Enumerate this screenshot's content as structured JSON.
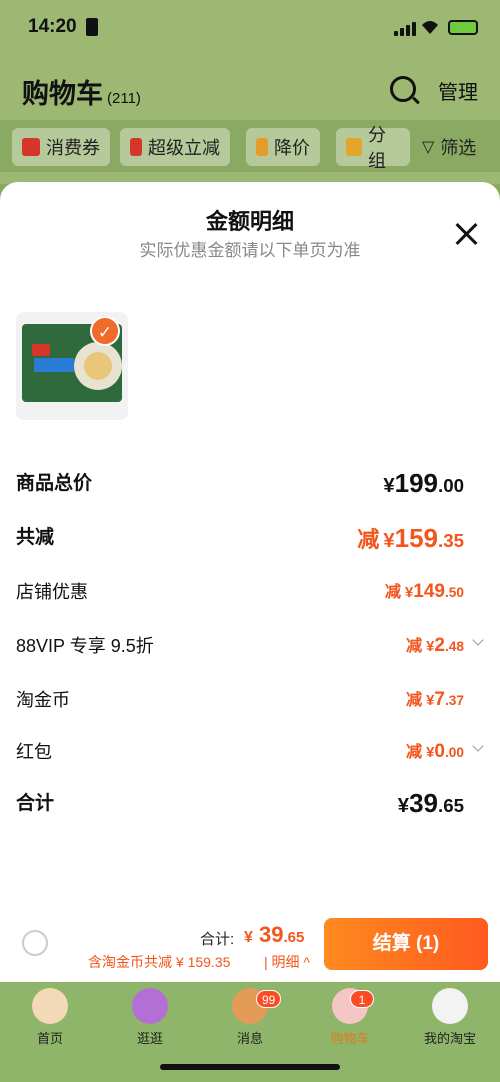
{
  "status": {
    "time": "14:20"
  },
  "header": {
    "title": "购物车",
    "count": "(211)",
    "manage_label": "管理"
  },
  "chips": [
    {
      "label": "消费券",
      "color": "#d8352a"
    },
    {
      "label": "超级立减",
      "color": "#d8352a"
    },
    {
      "label": "降价",
      "color": "#e39b2a"
    },
    {
      "label": "分组",
      "color": "#e3a52a"
    },
    {
      "label": "筛选",
      "color": "#333333"
    }
  ],
  "sheet": {
    "title": "金额明细",
    "subtitle": "实际优惠金额请以下单页为准",
    "rows": [
      {
        "label": "商品总价",
        "prefix": "",
        "currency": "¥",
        "integer": "199",
        "decimal": ".00"
      },
      {
        "label": "共减",
        "prefix": "减",
        "currency": "¥",
        "integer": "159",
        "decimal": ".35"
      },
      {
        "label": "店铺优惠",
        "prefix": "减",
        "currency": "¥",
        "integer": "149",
        "decimal": ".50"
      },
      {
        "label": "88VIP 专享 9.5折",
        "prefix": "减",
        "currency": "¥",
        "integer": "2",
        "decimal": ".48"
      },
      {
        "label": "淘金币",
        "prefix": "减",
        "currency": "¥",
        "integer": "7",
        "decimal": ".37"
      },
      {
        "label": "红包",
        "prefix": "减",
        "currency": "¥",
        "integer": "0",
        "decimal": ".00"
      },
      {
        "label": "合计",
        "prefix": "",
        "currency": "¥",
        "integer": "39",
        "decimal": ".65"
      }
    ]
  },
  "bottom": {
    "total_label": "合计:",
    "total_currency": "¥",
    "total_integer": "39",
    "total_decimal": ".65",
    "coin_note": "含淘金币共减 ¥ 159.35",
    "detail_label": "| 明细 ^",
    "checkout_label": "结算 (1)"
  },
  "tabs": [
    {
      "label": "首页",
      "badge": ""
    },
    {
      "label": "逛逛",
      "badge": ""
    },
    {
      "label": "消息",
      "badge": "99"
    },
    {
      "label": "购物车",
      "badge": "1"
    },
    {
      "label": "我的淘宝",
      "badge": ""
    }
  ],
  "colors": {
    "accent": "#f2561d",
    "checkout": "#ff6a1f",
    "tabbar": "#8fb56b"
  }
}
